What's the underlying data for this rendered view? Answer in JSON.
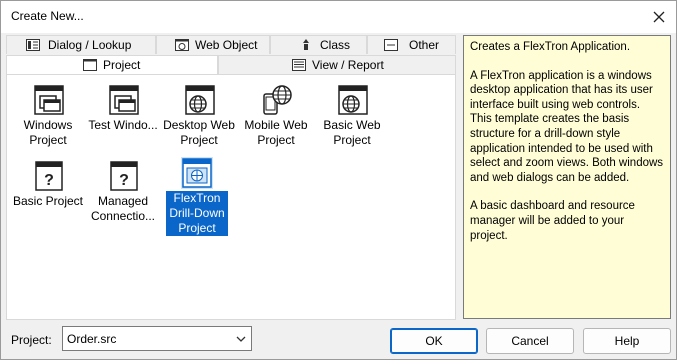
{
  "window": {
    "title": "Create New..."
  },
  "tabs_back": [
    {
      "label": "Dialog / Lookup",
      "icon": "dialog-icon"
    },
    {
      "label": "Web Object",
      "icon": "web-object-icon"
    },
    {
      "label": "Class",
      "icon": "class-icon"
    },
    {
      "label": "Other",
      "icon": "other-icon"
    }
  ],
  "tabs_front": [
    {
      "label": "Project",
      "icon": "window-icon",
      "active": true
    },
    {
      "label": "View / Report",
      "icon": "view-report-icon",
      "active": false
    }
  ],
  "items": [
    {
      "label": "Windows Project",
      "icon": "windows-project-icon",
      "selected": false
    },
    {
      "label": "Test Windo...",
      "icon": "test-windows-icon",
      "selected": false
    },
    {
      "label": "Desktop Web Project",
      "icon": "desktop-web-icon",
      "selected": false
    },
    {
      "label": "Mobile Web Project",
      "icon": "mobile-web-icon",
      "selected": false
    },
    {
      "label": "Basic Web Project",
      "icon": "basic-web-icon",
      "selected": false
    },
    {
      "label": "Basic Project",
      "icon": "question-doc-icon",
      "selected": false
    },
    {
      "label": "Managed Connectio...",
      "icon": "question-doc-icon",
      "selected": false
    },
    {
      "label": "FlexTron Drill-Down Project",
      "icon": "flextron-icon",
      "selected": true
    }
  ],
  "description": {
    "p1": "Creates a FlexTron Application.",
    "p2": "A FlexTron application is a windows desktop application that has its user interface built using web controls. This template creates the basis structure for a drill-down style application intended to be used with select and zoom views. Both windows and web dialogs can be added.",
    "p3": "A basic dashboard and resource manager will be added to your project."
  },
  "project_label": "Project:",
  "project_value": "Order.src",
  "buttons": {
    "ok": "OK",
    "cancel": "Cancel",
    "help": "Help"
  },
  "colors": {
    "selection": "#0a66c9",
    "description_bg": "#fffdd6"
  }
}
